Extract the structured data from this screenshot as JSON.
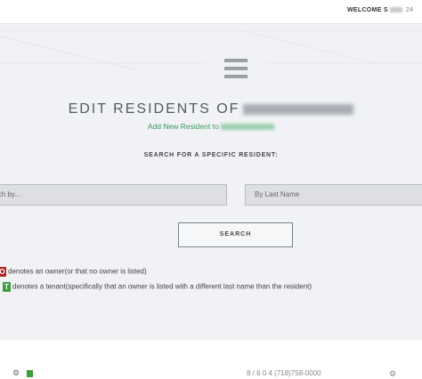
{
  "header": {
    "welcome_label": "WELCOME S",
    "right_fragment": "24"
  },
  "main": {
    "title_prefix": "EDIT RESIDENTS OF",
    "add_link_prefix": "Add New Resident to",
    "search_heading": "SEARCH FOR A SPECIFIC RESIDENT:",
    "search_input_placeholder": "rch by...",
    "lastname_placeholder": "By Last Name",
    "search_button": "SEARCH"
  },
  "legend": {
    "owner_badge": "O",
    "owner_text": "denotes an owner(or that no owner is listed)",
    "tenant_badge": "T",
    "tenant_text": "denotes a tenant(specifically that an owner is listed with a different last name than the resident)"
  },
  "footer": {
    "phone_fragment": "8 / 6 0   4   (718)758-0000"
  },
  "colors": {
    "panel_bg": "#f0f2f5",
    "link_green": "#3a9c5a",
    "owner_red": "#b22222",
    "tenant_green": "#3e9d3e"
  },
  "icons": [
    "menu-icon",
    "gear-icon",
    "document-icon"
  ]
}
